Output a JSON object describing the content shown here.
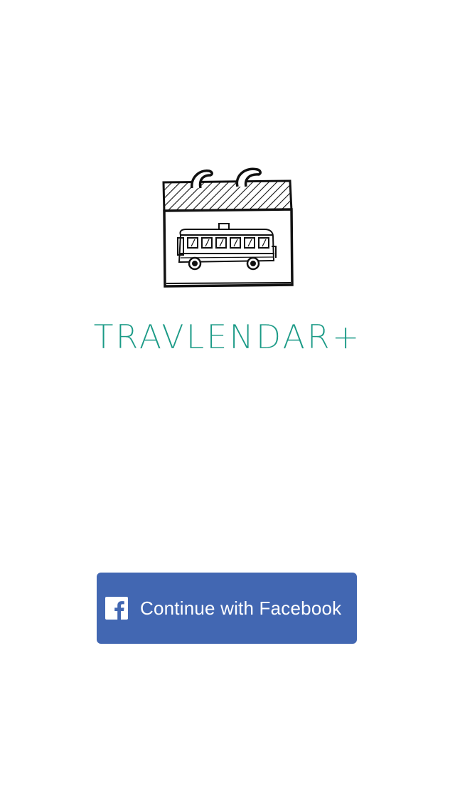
{
  "app": {
    "title": "TRAVLENDAR+",
    "logo_icon": "calendar-bus-icon",
    "accent_color": "#1a9a86"
  },
  "login": {
    "facebook_button_label": "Continue with Facebook",
    "facebook_icon": "facebook-icon",
    "facebook_color": "#4267b2"
  }
}
